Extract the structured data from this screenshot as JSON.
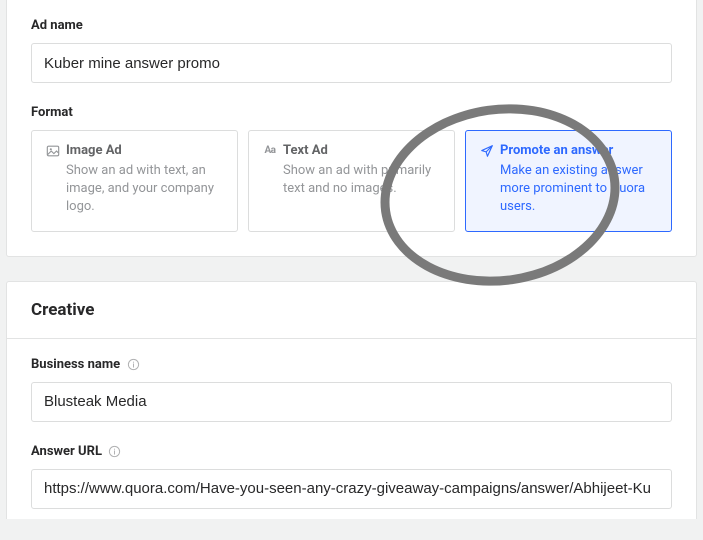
{
  "adNameSection": {
    "label": "Ad name",
    "value": "Kuber mine answer promo"
  },
  "formatSection": {
    "label": "Format",
    "options": [
      {
        "title": "Image Ad",
        "desc": "Show an ad with text, an image, and your company logo."
      },
      {
        "title": "Text Ad",
        "desc": "Show an ad with primarily text and no images."
      },
      {
        "title": "Promote an answer",
        "desc": "Make an existing answer more prominent to Quora users."
      }
    ]
  },
  "creativeSection": {
    "header": "Creative",
    "businessName": {
      "label": "Business name",
      "value": "Blusteak Media"
    },
    "answerUrl": {
      "label": "Answer URL",
      "value": "https://www.quora.com/Have-you-seen-any-crazy-giveaway-campaigns/answer/Abhijeet-Ku"
    }
  }
}
